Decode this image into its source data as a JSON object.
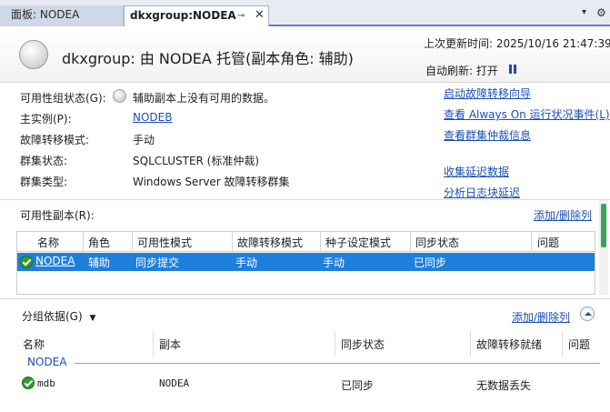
{
  "tabs": [
    {
      "label": "面板: NODEA",
      "active": false
    },
    {
      "label": "dkxgroup:NODEA",
      "active": true
    }
  ],
  "tab_icons": {
    "pin": "⊸",
    "close": "✕",
    "menu": "▾",
    "settings": "⚙"
  },
  "header": {
    "title": "dkxgroup: 由 NODEA 托管(副本角色: 辅助)",
    "last_updated_label": "上次更新时间:",
    "last_updated_value": "2025/10/16 21:47:39",
    "auto_refresh_label": "自动刷新:",
    "auto_refresh_value": "打开"
  },
  "properties": [
    {
      "label": "可用性组状态(G):",
      "value": "辅助副本上没有可用的数据。"
    },
    {
      "label": "主实例(P):",
      "value": "NODEB"
    },
    {
      "label": "故障转移模式:",
      "value": "手动"
    },
    {
      "label": "群集状态:",
      "value": "SQLCLUSTER (标准仲裁)"
    },
    {
      "label": "群集类型:",
      "value": "Windows Server 故障转移群集"
    }
  ],
  "actions": [
    "启动故障转移向导",
    "查看 Always On 运行状况事件(L)",
    "查看群集仲裁信息",
    "收集延迟数据",
    "分析日志块延迟"
  ],
  "replicas": {
    "section_label": "可用性副本(R):",
    "add_remove_label": "添加/删除列",
    "columns": [
      "名称",
      "角色",
      "可用性模式",
      "故障转移模式",
      "种子设定模式",
      "同步状态",
      "问题"
    ],
    "rows": [
      {
        "name": "NODEA",
        "role": "辅助",
        "availability_mode": "同步提交",
        "failover_mode": "手动",
        "seeding_mode": "手动",
        "sync_state": "已同步",
        "issues": ""
      }
    ]
  },
  "databases": {
    "group_by_label": "分组依据(G)",
    "add_remove_label": "添加/删除列",
    "columns": [
      "名称",
      "副本",
      "同步状态",
      "故障转移就绪",
      "问题"
    ],
    "group_name": "NODEA",
    "rows": [
      {
        "name": "mdb",
        "replica": "NODEA",
        "sync_state": "已同步",
        "failover_readiness": "无数据丢失",
        "issues": ""
      }
    ]
  }
}
